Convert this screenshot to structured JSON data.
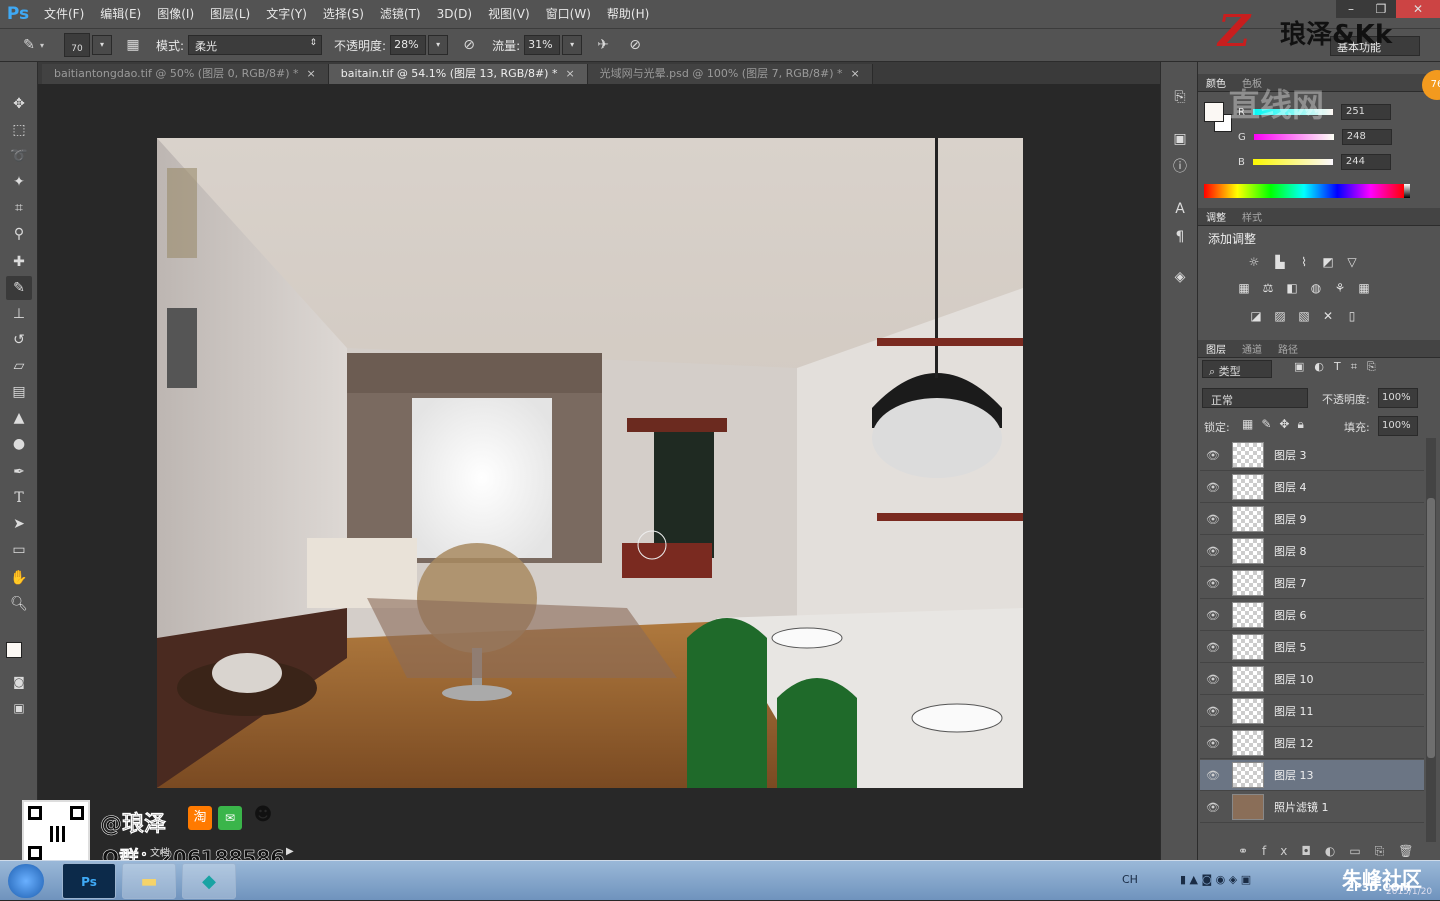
{
  "app": {
    "logo": "Ps"
  },
  "menu": [
    "文件(F)",
    "编辑(E)",
    "图像(I)",
    "图层(L)",
    "文字(Y)",
    "选择(S)",
    "滤镜(T)",
    "3D(D)",
    "视图(V)",
    "窗口(W)",
    "帮助(H)"
  ],
  "window_controls": {
    "minimize": "–",
    "restore": "❐",
    "close": "✕"
  },
  "options": {
    "brush_size": "70",
    "mode_label": "模式:",
    "mode_value": "柔光",
    "opacity_label": "不透明度:",
    "opacity_value": "28%",
    "flow_label": "流量:",
    "flow_value": "31%",
    "workspace_value": "基本功能"
  },
  "tabs": [
    {
      "label": "baitiantongdao.tif @ 50% (图层 0, RGB/8#) *",
      "close": "×"
    },
    {
      "label": "baitain.tif @ 54.1% (图层 13, RGB/8#) *",
      "close": "×"
    },
    {
      "label": "光域网与光晕.psd @ 100% (图层 7, RGB/8#) *",
      "close": "×"
    }
  ],
  "color_panel": {
    "tabs": [
      "颜色",
      "色板"
    ],
    "channels": [
      {
        "label": "R",
        "value": "251"
      },
      {
        "label": "G",
        "value": "248"
      },
      {
        "label": "B",
        "value": "244"
      }
    ],
    "foreground": "#fbf8f4"
  },
  "adjustments_panel": {
    "tabs": [
      "调整",
      "样式"
    ],
    "title": "添加调整"
  },
  "layers_panel": {
    "tabs": [
      "图层",
      "通道",
      "路径"
    ],
    "filter_label": "类型",
    "blend_mode": "正常",
    "opacity_label": "不透明度:",
    "opacity_value": "100%",
    "lock_label": "锁定:",
    "fill_label": "填充:",
    "fill_value": "100%",
    "layers": [
      {
        "name": "图层 3"
      },
      {
        "name": "图层 4"
      },
      {
        "name": "图层 9"
      },
      {
        "name": "图层 8"
      },
      {
        "name": "图层 7"
      },
      {
        "name": "图层 6"
      },
      {
        "name": "图层 5"
      },
      {
        "name": "图层 10"
      },
      {
        "name": "图层 11"
      },
      {
        "name": "图层 12"
      },
      {
        "name": "图层 13"
      },
      {
        "name": "照片滤镜 1"
      }
    ],
    "selected_index": 10
  },
  "watermarks": {
    "top_right": "琅泽&Kk",
    "center": "直线网",
    "handle": "@琅泽",
    "qq_group": "Q群：206188586",
    "bottom_right": "朱峰社区",
    "bottom_right_sub": "ZF3D.COM",
    "date": "2015/1/20"
  },
  "taskbar": {
    "apps": [
      "Ps",
      "",
      ""
    ],
    "tray": {
      "lang": "CH"
    }
  },
  "status": {
    "doc_label": "文档"
  }
}
